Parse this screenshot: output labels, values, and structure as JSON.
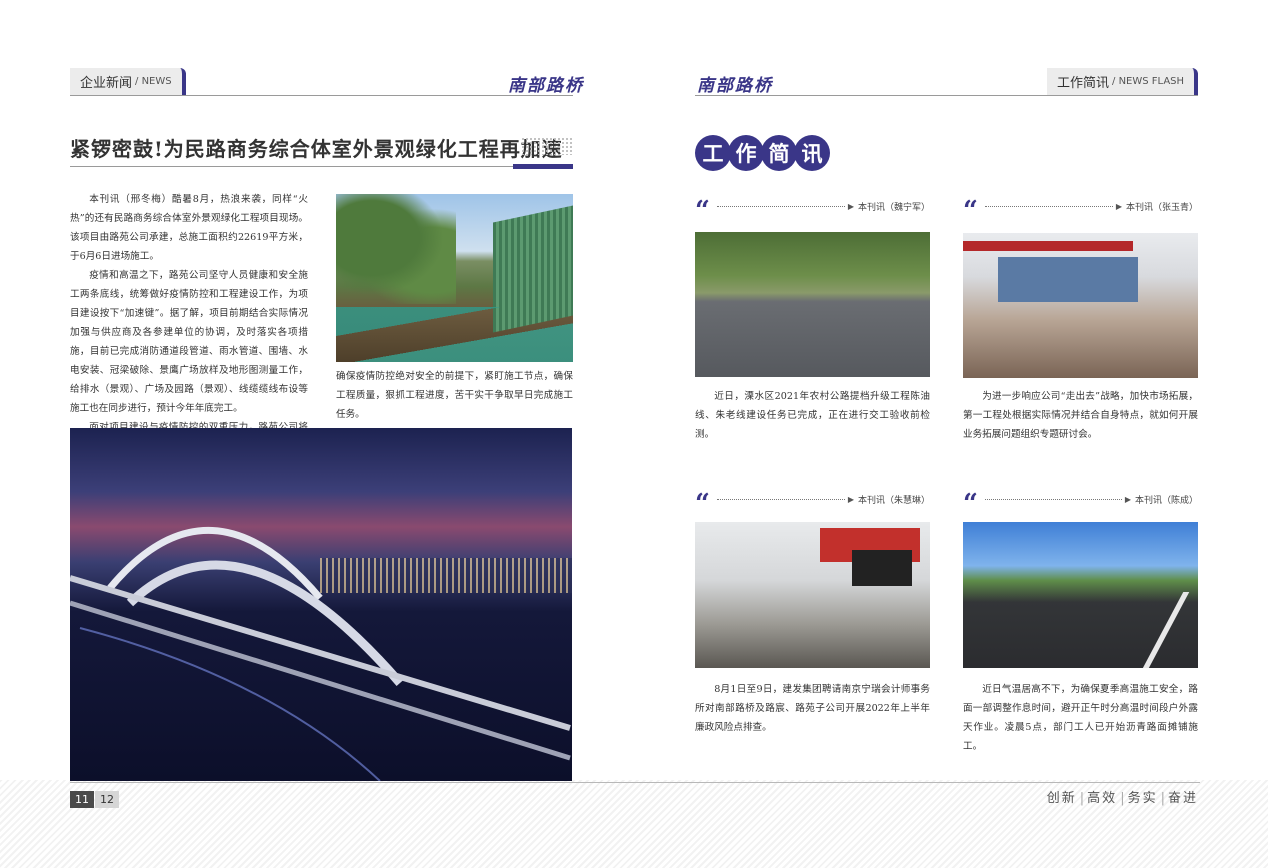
{
  "left_header": {
    "tab_cn": "企业新闻",
    "tab_en": "NEWS",
    "brand": "南部路桥"
  },
  "right_header": {
    "brand": "南部路桥",
    "tab_cn": "工作简讯",
    "tab_en": "NEWS FLASH"
  },
  "article": {
    "headline": "紧锣密鼓!为民路商务综合体室外景观绿化工程再加速",
    "paragraphs": [
      "本刊讯（邢冬梅）酷暑8月，热浪来袭，同样“火热”的还有民路商务综合体室外景观绿化工程项目现场。该项目由路苑公司承建，总施工面积约22619平方米，于6月6日进场施工。",
      "疫情和高温之下，路苑公司坚守人员健康和安全施工两条底线，统筹做好疫情防控和工程建设工作，为项目建设按下“加速键”。据了解，项目前期结合实际情况加强与供应商及各参建单位的协调，及时落实各项措施，目前已完成消防通道段管道、雨水管道、围墙、水电安装、冠梁破除、景鹰广场放样及地形图测量工作，给排水（景观）、广场及园路（景观）、线缆缆线布设等施工也在同步进行，预计今年年底完工。",
      "面对项目建设与疫情防控的双重压力，路苑公司将在"
    ],
    "continued": "确保疫情防控绝对安全的前提下，紧盯施工节点，确保工程质量，狠抓工程进度，苦干实干争取早日完成施工任务。"
  },
  "briefs": {
    "title_chars": [
      "工",
      "作",
      "简",
      "讯"
    ],
    "items": [
      {
        "byline": "本刊讯（魏宁军）",
        "text": "近日，溧水区2021年农村公路提档升级工程陈油线、朱老线建设任务已完成，正在进行交工验收前检测。"
      },
      {
        "byline": "本刊讯（张玉青）",
        "text": "为进一步响应公司“走出去”战略，加快市场拓展，第一工程处根据实际情况并结合自身特点，就如何开展业务拓展问题组织专题研讨会。"
      },
      {
        "byline": "本刊讯（朱慧琳）",
        "text": "8月1日至9日，建发集团聘请南京宁瑞会计师事务所对南部路桥及路宸、路苑子公司开展2022年上半年廉政风险点排查。"
      },
      {
        "byline": "本刊讯（陈成）",
        "text": "近日气温居高不下，为确保夏季高温施工安全，路面一部调整作息时间，避开正午时分高温时间段户外露天作业。凌晨5点，部门工人已开始沥青路面摊铺施工。"
      }
    ]
  },
  "footer": {
    "page_left": "11",
    "page_right": "12",
    "slogan": [
      "创新",
      "高效",
      "务实",
      "奋进"
    ]
  },
  "colors": {
    "accent": "#3a3688",
    "page_number_dark": "#4a4a4a"
  }
}
